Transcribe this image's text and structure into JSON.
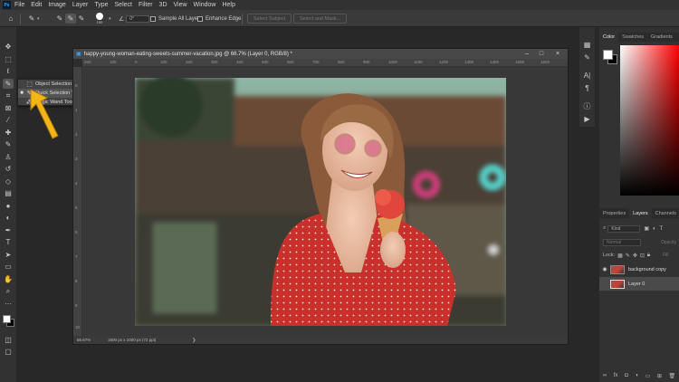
{
  "app": {
    "logo_text": "Ps"
  },
  "menu": [
    "File",
    "Edit",
    "Image",
    "Layer",
    "Type",
    "Select",
    "Filter",
    "3D",
    "View",
    "Window",
    "Help"
  ],
  "options_bar": {
    "home_icon": "home-icon",
    "brush_size": "100",
    "angle_value": "0°",
    "sample_all_layers": "Sample All Layers",
    "enhance_edge": "Enhance Edge",
    "select_subject": "Select Subject",
    "select_and_mask": "Select and Mask..."
  },
  "flyout": {
    "items": [
      {
        "label": "Object Selection Tool",
        "shortcut": "W",
        "selected": false,
        "icon": "object-selection-icon"
      },
      {
        "label": "Quick Selection Tool",
        "shortcut": "W",
        "selected": true,
        "icon": "quick-selection-icon"
      },
      {
        "label": "Magic Wand Tool",
        "shortcut": "W",
        "selected": false,
        "icon": "magic-wand-icon"
      }
    ]
  },
  "document": {
    "title": "happy-young-woman-eating-sweets-summer-vacation.jpg @ 66.7% (Layer 0, RGB/8) *",
    "zoom": "66.67%",
    "dimensions": "1500 px x 1000 px (72 ppi)",
    "ruler_top": [
      "200",
      "100",
      "0",
      "100",
      "200",
      "300",
      "400",
      "500",
      "600",
      "700",
      "800",
      "900",
      "1000",
      "1100",
      "1200",
      "1300",
      "1400",
      "1500",
      "1600"
    ],
    "ruler_left": [
      "0",
      "1",
      "2",
      "3",
      "4",
      "5",
      "6",
      "7",
      "8",
      "9",
      "10"
    ]
  },
  "color_panel": {
    "tabs": [
      "Color",
      "Swatches",
      "Gradients"
    ],
    "foreground": "#ffffff",
    "background": "#000000",
    "hue": "#ff0000"
  },
  "layers_panel": {
    "tabs": [
      "Properties",
      "Layers",
      "Channels"
    ],
    "filter_label": "Kind",
    "blend_mode": "Normal",
    "opacity_label": "Opacity",
    "lock_label": "Lock:",
    "fill_label": "Fill",
    "layers": [
      {
        "name": "background copy",
        "visible": true,
        "selected": false
      },
      {
        "name": "Layer 0",
        "visible": false,
        "selected": true
      }
    ]
  },
  "colors": {
    "accent": "#31a8ff",
    "panel": "#323232",
    "dress": "#c9302c"
  }
}
